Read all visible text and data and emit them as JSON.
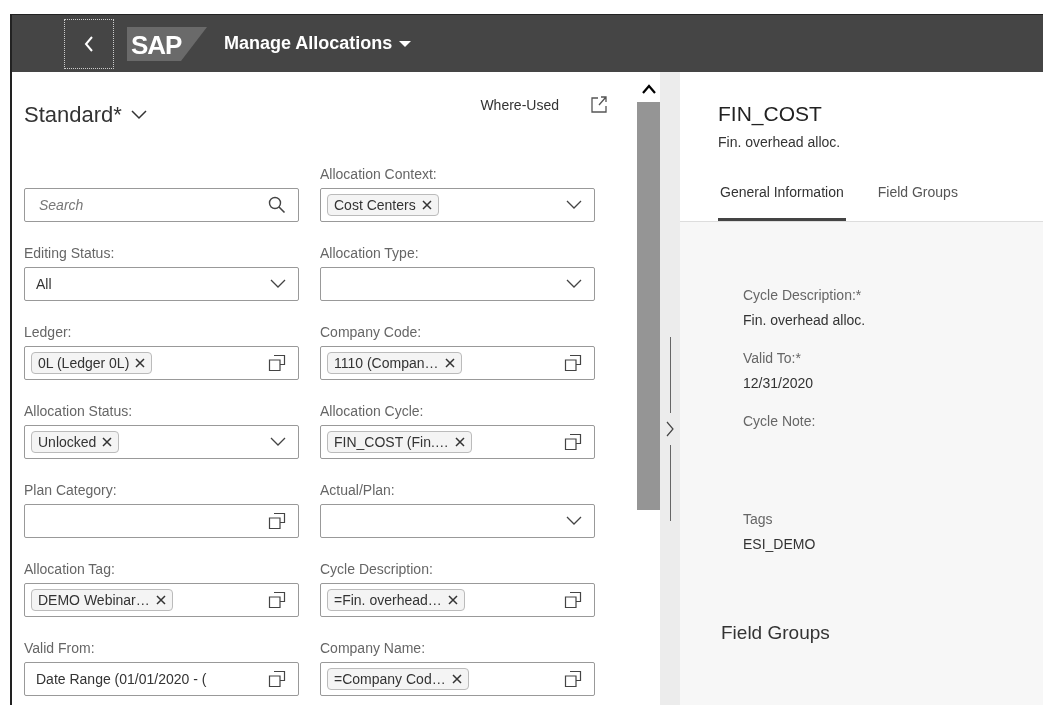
{
  "shell": {
    "logo": "SAP",
    "title": "Manage Allocations"
  },
  "filter_bar": {
    "variant": "Standard*",
    "where_used": "Where-Used",
    "filters": [
      {
        "kind": "search",
        "placeholder": "Search"
      },
      {
        "kind": "select",
        "label": "Allocation Context:",
        "token": "Cost Centers"
      },
      {
        "kind": "select",
        "label": "Editing Status:",
        "value": "All"
      },
      {
        "kind": "select",
        "label": "Allocation Type:"
      },
      {
        "kind": "valuehelp",
        "label": "Ledger:",
        "token": "0L (Ledger 0L)"
      },
      {
        "kind": "valuehelp",
        "label": "Company Code:",
        "token": "1110 (Compan…"
      },
      {
        "kind": "select",
        "label": "Allocation Status:",
        "token": "Unlocked"
      },
      {
        "kind": "valuehelp",
        "label": "Allocation Cycle:",
        "token": "FIN_COST (Fin.…"
      },
      {
        "kind": "valuehelp",
        "label": "Plan Category:"
      },
      {
        "kind": "select",
        "label": "Actual/Plan:"
      },
      {
        "kind": "valuehelp",
        "label": "Allocation Tag:",
        "token": "DEMO Webinar…"
      },
      {
        "kind": "valuehelp",
        "label": "Cycle Description:",
        "token": "=Fin. overhead…"
      },
      {
        "kind": "valuehelp",
        "label": "Valid From:",
        "value": "Date Range (01/01/2020 - ("
      },
      {
        "kind": "valuehelp",
        "label": "Company Name:",
        "token": "=Company Cod…"
      }
    ]
  },
  "detail": {
    "title": "FIN_COST",
    "subtitle": "Fin. overhead alloc.",
    "tabs": [
      {
        "label": "General Information",
        "selected": true
      },
      {
        "label": "Field Groups",
        "selected": false
      }
    ],
    "fields": [
      {
        "label": "Cycle Description:*",
        "value": "Fin. overhead alloc."
      },
      {
        "label": "Valid To:*",
        "value": "12/31/2020"
      },
      {
        "label": "Cycle Note:"
      },
      {
        "label": "Tags",
        "value": "ESI_DEMO"
      }
    ],
    "section_heading": "Field Groups"
  }
}
